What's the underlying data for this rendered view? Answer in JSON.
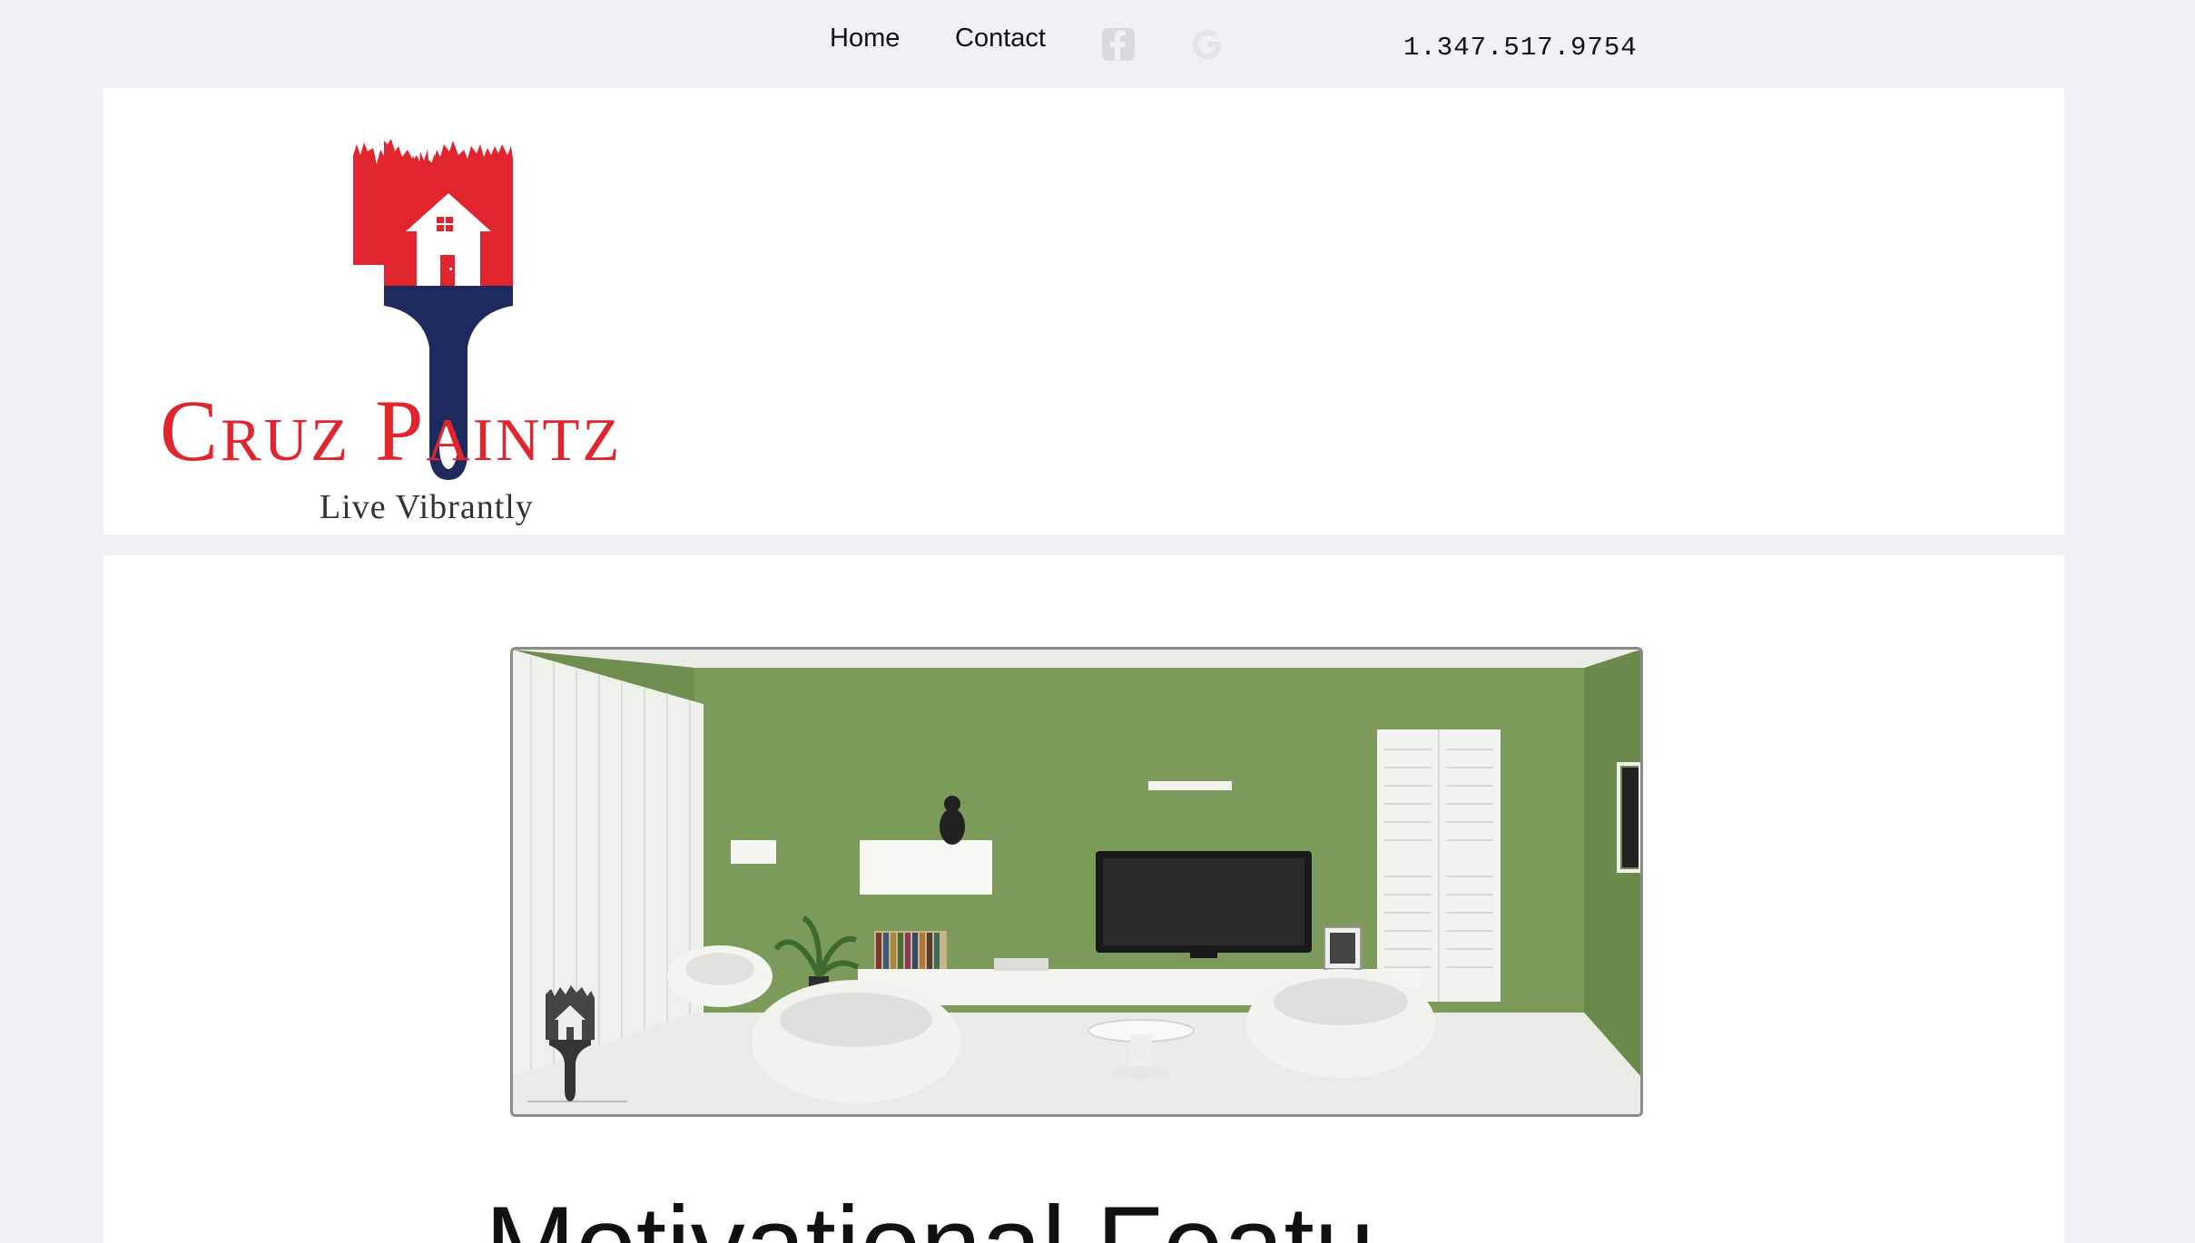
{
  "nav": {
    "home_label": "Home",
    "contact_label": "Contact",
    "social": [
      "facebook-icon",
      "google-icon"
    ],
    "phone": "1.347.517.9754"
  },
  "logo": {
    "name": "Cruz Paintz",
    "tagline": "Live Vibrantly"
  },
  "hero": {
    "image": "green living room interior with white furniture, TV and logo watermark"
  },
  "content": {
    "heading": "Motivational Featu"
  },
  "colors": {
    "background": "#f0f0f5",
    "card": "#ffffff",
    "brand_red": "#e1252f",
    "brand_navy": "#1e2a5e",
    "wall_green": "#7c9a5a"
  }
}
